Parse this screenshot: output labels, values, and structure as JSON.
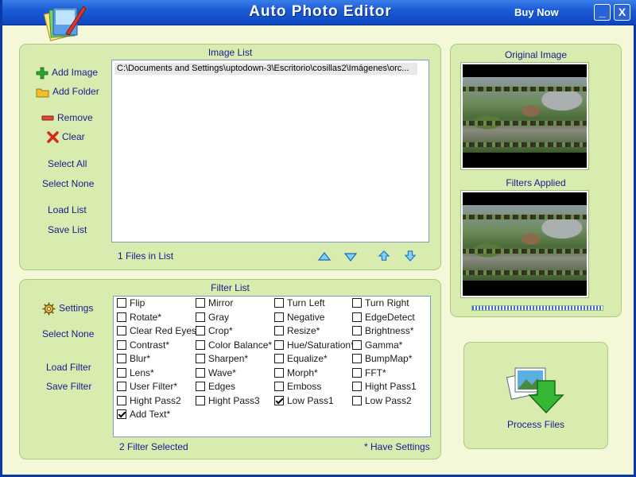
{
  "window": {
    "title": "Auto Photo Editor",
    "buy_now": "Buy Now",
    "minimize_glyph": "_",
    "close_glyph": "X"
  },
  "image_list": {
    "title": "Image List",
    "files": [
      "C:\\Documents and Settings\\uptodown-3\\Escritorio\\cosillas2\\Imágenes\\orc..."
    ],
    "count_label": "1 Files in List",
    "actions": {
      "add_image": "Add Image",
      "add_folder": "Add Folder",
      "remove": "Remove",
      "clear": "Clear",
      "select_all": "Select All",
      "select_none": "Select None",
      "load_list": "Load List",
      "save_list": "Save List"
    }
  },
  "filter_list": {
    "title": "Filter List",
    "actions": {
      "settings": "Settings",
      "select_none": "Select None",
      "load_filter": "Load Filter",
      "save_filter": "Save Filter"
    },
    "filters": [
      {
        "label": "Flip",
        "checked": false
      },
      {
        "label": "Mirror",
        "checked": false
      },
      {
        "label": "Turn Left",
        "checked": false
      },
      {
        "label": "Turn Right",
        "checked": false
      },
      {
        "label": "Rotate*",
        "checked": false
      },
      {
        "label": "Gray",
        "checked": false
      },
      {
        "label": "Negative",
        "checked": false
      },
      {
        "label": "EdgeDetect",
        "checked": false
      },
      {
        "label": "Clear Red Eyes",
        "checked": false
      },
      {
        "label": "Crop*",
        "checked": false
      },
      {
        "label": "Resize*",
        "checked": false
      },
      {
        "label": "Brightness*",
        "checked": false
      },
      {
        "label": "Contrast*",
        "checked": false
      },
      {
        "label": "Color Balance*",
        "checked": false
      },
      {
        "label": "Hue/Saturation*",
        "checked": false
      },
      {
        "label": "Gamma*",
        "checked": false
      },
      {
        "label": "Blur*",
        "checked": false
      },
      {
        "label": "Sharpen*",
        "checked": false
      },
      {
        "label": "Equalize*",
        "checked": false
      },
      {
        "label": "BumpMap*",
        "checked": false
      },
      {
        "label": "Lens*",
        "checked": false
      },
      {
        "label": "Wave*",
        "checked": false
      },
      {
        "label": "Morph*",
        "checked": false
      },
      {
        "label": "FFT*",
        "checked": false
      },
      {
        "label": "User Filter*",
        "checked": false
      },
      {
        "label": "Edges",
        "checked": false
      },
      {
        "label": "Emboss",
        "checked": false
      },
      {
        "label": "Hight Pass1",
        "checked": false
      },
      {
        "label": "Hight Pass2",
        "checked": false
      },
      {
        "label": "Hight Pass3",
        "checked": false
      },
      {
        "label": "Low Pass1",
        "checked": true
      },
      {
        "label": "Low Pass2",
        "checked": false
      },
      {
        "label": "Add Text*",
        "checked": true
      }
    ],
    "selected_label": "2 Filter Selected",
    "settings_note": "* Have Settings"
  },
  "preview": {
    "original_title": "Original Image",
    "filtered_title": "Filters Applied"
  },
  "process": {
    "label": "Process Files"
  },
  "colors": {
    "accent_text": "#1a1a8c",
    "panel_bg": "#d8ecb0",
    "window_bg": "#f4f8d8",
    "titlebar": "#1b5cd6"
  }
}
